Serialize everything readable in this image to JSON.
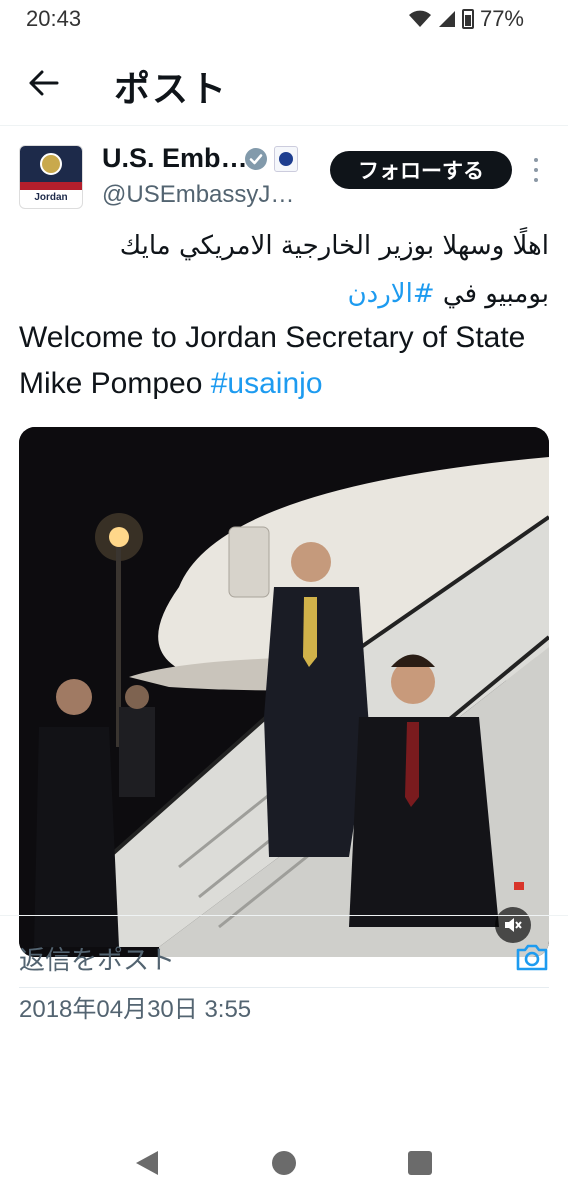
{
  "status_bar": {
    "time": "20:43",
    "battery": "77%"
  },
  "header": {
    "title": "ポスト",
    "back_icon": "arrow-left-icon"
  },
  "post": {
    "author_name": "U.S. Emb…",
    "author_handle": "@USEmbassyJ…",
    "avatar_label": "Jordan",
    "follow_label": "フォローする",
    "text_ar_line1": "اهلًا وسهلا بوزير الخارجية الامريكي مايك",
    "text_ar_line2_prefix": "بومبيو في ",
    "text_ar_hashtag": "#الاردن",
    "text_en_prefix": "Welcome to Jordan Secretary of State  Mike Pompeo ",
    "text_en_hashtag": "#usainjo",
    "date": "2018年04月30日 3:55"
  },
  "reply": {
    "placeholder": "返信をポスト",
    "camera_icon": "camera-icon"
  },
  "colors": {
    "accent": "#1d9bf0",
    "text": "#0f1419",
    "muted": "#536471",
    "follow_bg": "#0f1419"
  }
}
